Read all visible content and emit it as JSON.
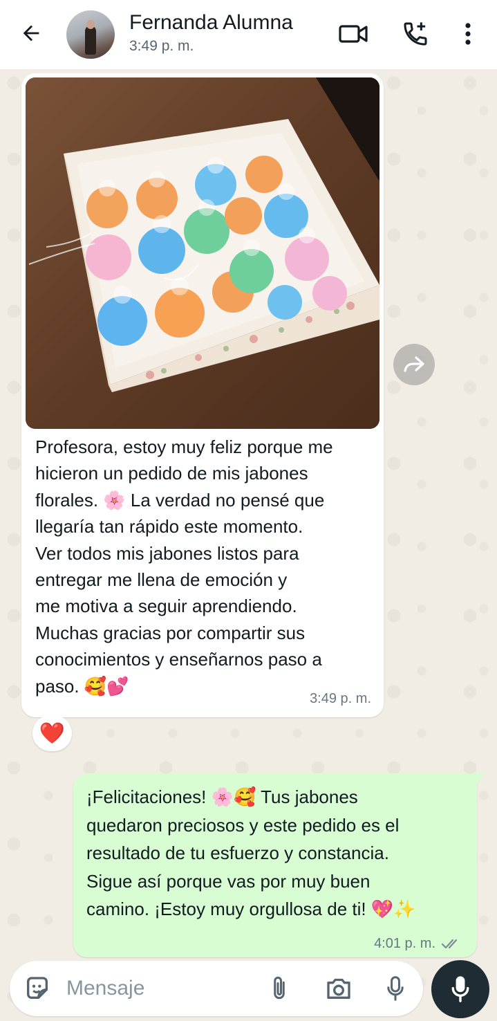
{
  "header": {
    "contact_name": "Fernanda Alumna",
    "status": "3:49 p. m.",
    "back_icon": "arrow-left-icon",
    "video_icon": "video-call-icon",
    "call_icon": "add-call-icon",
    "menu_icon": "more-vertical-icon"
  },
  "incoming": {
    "image_alt": "Caja de jabones florales",
    "text": "Profesora, estoy muy feliz porque me\nhicieron un pedido de mis jabones\nflorales. 🌸 La verdad no pensé que\nllegaría tan rápido este momento.\nVer todos mis jabones listos para\nentregar me llena de emoción y\nme motiva a seguir aprendiendo.\nMuchas gracias por compartir sus\nconocimientos y enseñarnos paso a\npaso. 🥰💕",
    "time": "3:49 p. m.",
    "reaction": "❤️",
    "forward_icon": "forward-icon"
  },
  "outgoing": {
    "text": "¡Felicitaciones! 🌸🥰 Tus jabones\nquedaron preciosos y este pedido es el\nresultado de tu esfuerzo y constancia.\nSigue así porque vas por muy buen\ncamino. ¡Estoy muy orgullosa de ti! 💖✨",
    "time": "4:01 p. m.",
    "status_icon": "double-check-icon"
  },
  "composer": {
    "placeholder": "Mensaje",
    "value": ""
  },
  "colors": {
    "outgoing_bubble": "#d9fdd3",
    "incoming_bubble": "#ffffff",
    "wallpaper": "#f1ece4",
    "fab": "#1f2c34"
  }
}
